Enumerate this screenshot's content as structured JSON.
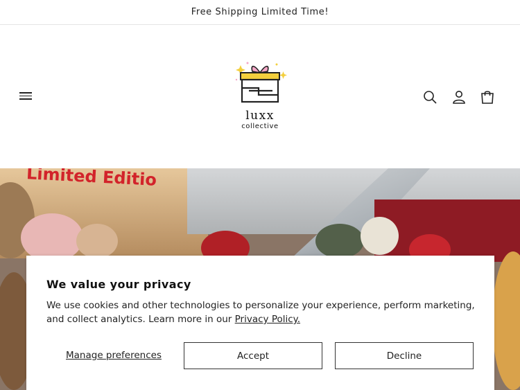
{
  "announcement": {
    "text": "Free Shipping Limited Time!"
  },
  "header": {
    "logo_name": "luxx",
    "logo_sub": "collective",
    "icons": [
      "hamburger-menu-icon",
      "search-icon",
      "account-icon",
      "cart-icon"
    ]
  },
  "hero": {
    "banner_text": "Limited Editio"
  },
  "cookie": {
    "title": "We value your privacy",
    "body": "We use cookies and other technologies to personalize your experience, perform marketing, and collect analytics. Learn more in our ",
    "policy_link": "Privacy Policy.",
    "manage_label": "Manage preferences",
    "accept_label": "Accept",
    "decline_label": "Decline"
  },
  "colors": {
    "accent_yellow": "#f3cf3d",
    "accent_pink": "#f4a6c6",
    "banner_red": "#d2232a"
  }
}
